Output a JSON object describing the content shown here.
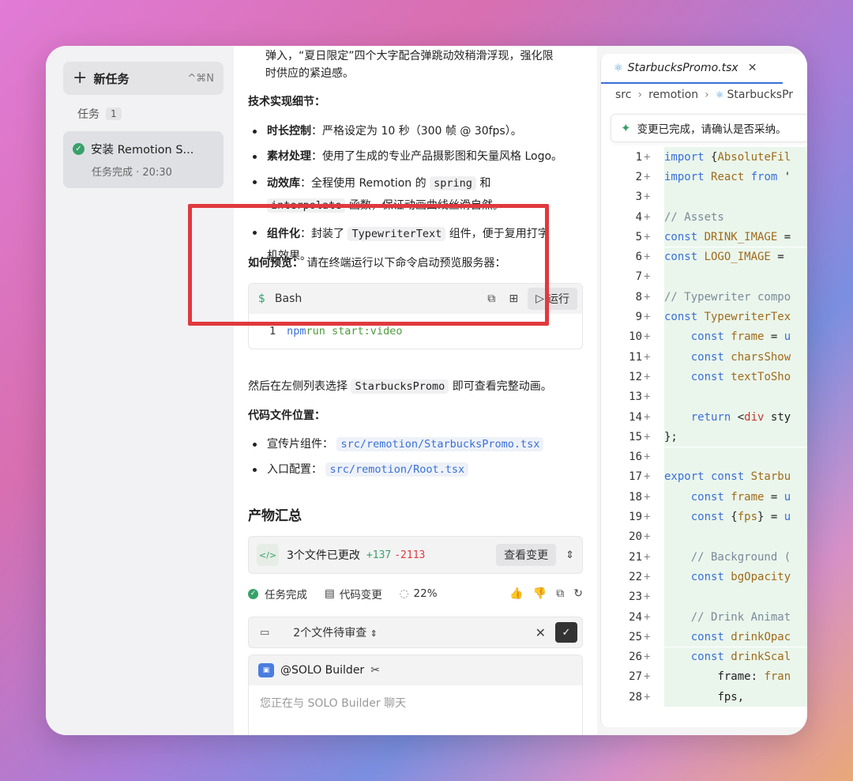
{
  "sidebar": {
    "new_task_label": "新任务",
    "new_task_shortcut": "^⌘N",
    "tasks_heading": "任务",
    "tasks_count": "1",
    "task": {
      "title": "安装 Remotion S...",
      "meta": "任务完成 · 20:30"
    }
  },
  "chat": {
    "top_text_1": "弹入，“夏日限定”四个大字配合弹跳动效稍滑浮现，强化限",
    "top_text_2": "时供应的紧迫感。",
    "tech_heading": "技术实现细节：",
    "bullets": [
      {
        "title": "时长控制",
        "text": "：严格设定为 10 秒（300 帧 @ 30fps）。"
      },
      {
        "title": "素材处理",
        "text": "：使用了生成的专业产品摄影图和矢量风格 Logo。"
      },
      {
        "title": "动效库",
        "pre": "：全程使用 Remotion 的 ",
        "code1": "spring",
        "mid": " 和",
        "code2": "interpolate",
        "post": " 函数，保证动画曲线丝滑自然。"
      },
      {
        "title": "组件化",
        "pre": "：封装了 ",
        "code1": "TypewriterText",
        "post": " 组件，便于复用打字",
        "tail": "机效果。"
      }
    ],
    "preview_heading": "如何预览：",
    "preview_text": "请在终端运行以下命令启动预览服务器：",
    "bash": {
      "lang": "Bash",
      "run_label": "运行",
      "line_no": "1",
      "cmd": "npm",
      "args": " run start:video"
    },
    "after_pre": "然后在左侧列表选择 ",
    "after_code": "StarbucksPromo",
    "after_post": " 即可查看完整动画。",
    "files_heading": "代码文件位置：",
    "files": [
      {
        "label": "宣传片组件：",
        "path": "src/remotion/StarbucksPromo.tsx"
      },
      {
        "label": "入口配置：",
        "path": "src/remotion/Root.tsx"
      }
    ],
    "artifacts_heading": "产物汇总",
    "changes": {
      "text": "3个文件已更改",
      "plus": "+137",
      "minus": "-2113",
      "view_label": "查看变更"
    },
    "status": {
      "done": "任务完成",
      "changes": "代码变更",
      "progress": "22%"
    },
    "review": {
      "text": "2个文件待审查"
    },
    "input": {
      "bot_name": "@SOLO Builder",
      "placeholder": "您正在与 SOLO Builder 聊天"
    }
  },
  "editor": {
    "tab_name": "StarbucksPromo.tsx",
    "crumbs": [
      "src",
      "remotion",
      "StarbucksPr"
    ],
    "notice": "变更已完成，请确认是否采纳。",
    "lines": [
      {
        "n": "1",
        "parts": [
          [
            "kw",
            "import "
          ],
          [
            "pl",
            "{"
          ],
          [
            "vr",
            "AbsoluteFil"
          ]
        ]
      },
      {
        "n": "2",
        "parts": [
          [
            "kw",
            "import "
          ],
          [
            "vr",
            "React "
          ],
          [
            "kw",
            "from "
          ],
          [
            "pl",
            "'"
          ]
        ]
      },
      {
        "n": "3",
        "parts": []
      },
      {
        "n": "4",
        "parts": [
          [
            "cm",
            "// Assets"
          ]
        ]
      },
      {
        "n": "5",
        "parts": [
          [
            "kw",
            "const "
          ],
          [
            "vr",
            "DRINK_IMAGE "
          ],
          [
            "pl",
            "="
          ]
        ]
      },
      {
        "n": "6",
        "parts": [
          [
            "kw",
            "const "
          ],
          [
            "vr",
            "LOGO_IMAGE "
          ],
          [
            "pl",
            "="
          ]
        ]
      },
      {
        "n": "7",
        "parts": []
      },
      {
        "n": "8",
        "parts": [
          [
            "cm",
            "// Typewriter compo"
          ]
        ]
      },
      {
        "n": "9",
        "parts": [
          [
            "kw",
            "const "
          ],
          [
            "vr",
            "TypewriterTex"
          ]
        ]
      },
      {
        "n": "10",
        "parts": [
          [
            "pl",
            "    "
          ],
          [
            "kw",
            "const "
          ],
          [
            "vr",
            "frame "
          ],
          [
            "pl",
            "= "
          ],
          [
            "kw",
            "u"
          ]
        ]
      },
      {
        "n": "11",
        "parts": [
          [
            "pl",
            "    "
          ],
          [
            "kw",
            "const "
          ],
          [
            "vr",
            "charsShow"
          ]
        ]
      },
      {
        "n": "12",
        "parts": [
          [
            "pl",
            "    "
          ],
          [
            "kw",
            "const "
          ],
          [
            "vr",
            "textToSho"
          ]
        ]
      },
      {
        "n": "13",
        "parts": []
      },
      {
        "n": "14",
        "parts": [
          [
            "pl",
            "    "
          ],
          [
            "kw",
            "return "
          ],
          [
            "pl",
            "<"
          ],
          [
            "tg",
            "div "
          ],
          [
            "pl",
            "sty"
          ]
        ]
      },
      {
        "n": "15",
        "parts": [
          [
            "pl",
            "};"
          ]
        ]
      },
      {
        "n": "16",
        "parts": []
      },
      {
        "n": "17",
        "parts": [
          [
            "kw",
            "export const "
          ],
          [
            "vr",
            "Starbu"
          ]
        ]
      },
      {
        "n": "18",
        "parts": [
          [
            "pl",
            "    "
          ],
          [
            "kw",
            "const "
          ],
          [
            "vr",
            "frame "
          ],
          [
            "pl",
            "= "
          ],
          [
            "kw",
            "u"
          ]
        ]
      },
      {
        "n": "19",
        "parts": [
          [
            "pl",
            "    "
          ],
          [
            "kw",
            "const "
          ],
          [
            "pl",
            "{"
          ],
          [
            "vr",
            "fps"
          ],
          [
            "pl",
            "} = "
          ],
          [
            "kw",
            "u"
          ]
        ]
      },
      {
        "n": "20",
        "parts": []
      },
      {
        "n": "21",
        "parts": [
          [
            "pl",
            "    "
          ],
          [
            "cm",
            "// Background ("
          ]
        ]
      },
      {
        "n": "22",
        "parts": [
          [
            "pl",
            "    "
          ],
          [
            "kw",
            "const "
          ],
          [
            "vr",
            "bgOpacity"
          ]
        ]
      },
      {
        "n": "23",
        "parts": []
      },
      {
        "n": "24",
        "parts": [
          [
            "pl",
            "    "
          ],
          [
            "cm",
            "// Drink Animat"
          ]
        ]
      },
      {
        "n": "25",
        "parts": [
          [
            "pl",
            "    "
          ],
          [
            "kw",
            "const "
          ],
          [
            "vr",
            "drinkOpac"
          ]
        ]
      },
      {
        "n": "26",
        "parts": [
          [
            "pl",
            "    "
          ],
          [
            "kw",
            "const "
          ],
          [
            "vr",
            "drinkScal"
          ]
        ]
      },
      {
        "n": "27",
        "parts": [
          [
            "pl",
            "        "
          ],
          [
            "pl",
            "frame: "
          ],
          [
            "vr",
            "fran"
          ]
        ]
      },
      {
        "n": "28",
        "parts": [
          [
            "pl",
            "        "
          ],
          [
            "pl",
            "fps,"
          ]
        ]
      }
    ]
  }
}
